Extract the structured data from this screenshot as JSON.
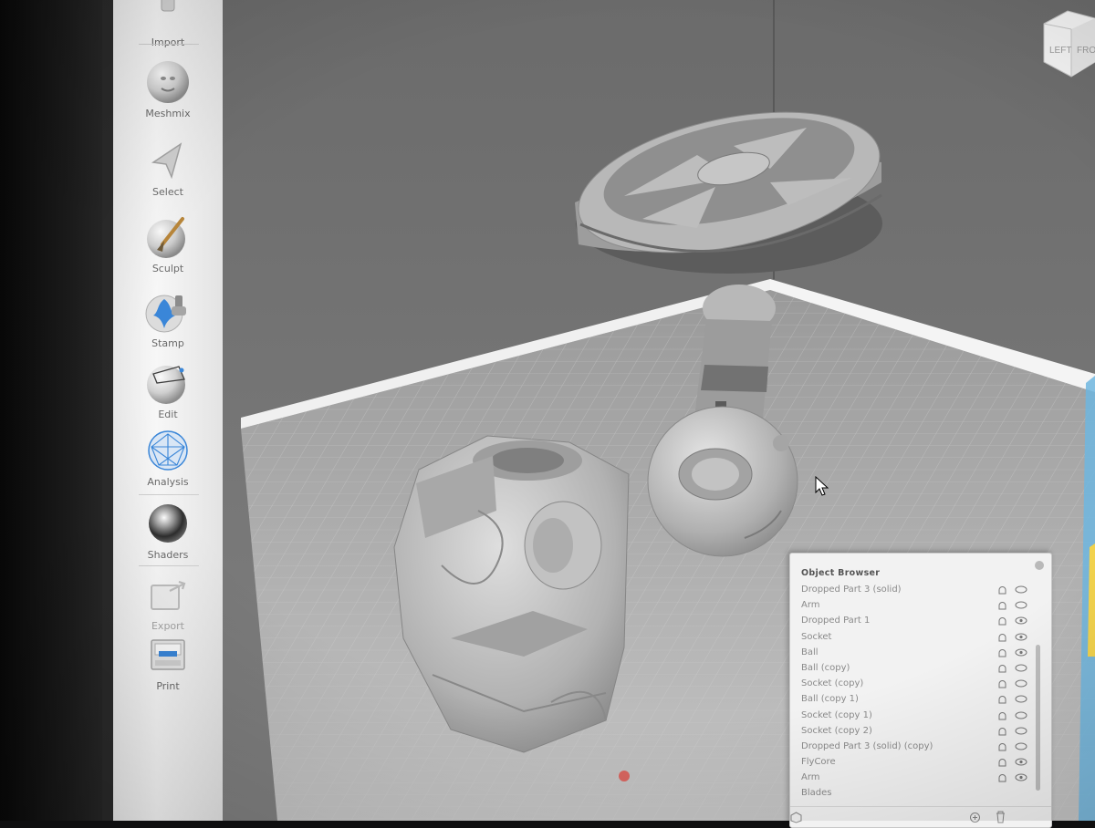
{
  "toolbar": {
    "items": [
      {
        "label": "Import",
        "icon": "import-icon"
      },
      {
        "label": "Meshmix",
        "icon": "meshmix-icon"
      },
      {
        "label": "Select",
        "icon": "select-arrow-icon"
      },
      {
        "label": "Sculpt",
        "icon": "sculpt-brush-icon"
      },
      {
        "label": "Stamp",
        "icon": "stamp-icon"
      },
      {
        "label": "Edit",
        "icon": "edit-sphere-icon"
      },
      {
        "label": "Analysis",
        "icon": "analysis-mesh-icon"
      },
      {
        "label": "Shaders",
        "icon": "shaders-sphere-icon"
      },
      {
        "label": "Export",
        "icon": "export-icon"
      },
      {
        "label": "Print",
        "icon": "printer-icon"
      }
    ]
  },
  "viewcube": {
    "left_label": "LEFT",
    "front_label": "FRO"
  },
  "object_browser": {
    "title": "Object Browser",
    "items": [
      {
        "label": "Dropped Part 3 (solid)"
      },
      {
        "label": "Arm"
      },
      {
        "label": "Dropped Part 1"
      },
      {
        "label": "Socket"
      },
      {
        "label": "Ball"
      },
      {
        "label": "Ball (copy)"
      },
      {
        "label": "Socket (copy)"
      },
      {
        "label": "Ball (copy 1)"
      },
      {
        "label": "Socket (copy 1)"
      },
      {
        "label": "Socket (copy 2)"
      },
      {
        "label": "Dropped Part 3 (solid) (copy)"
      },
      {
        "label": "FlyCore"
      },
      {
        "label": "Arm"
      },
      {
        "label": "Blades"
      }
    ]
  },
  "colors": {
    "toolbar_bg": "#efefef",
    "viewport_bg": "#727272",
    "model_gray": "#b4b4b4",
    "selection_blue": "#3d7ad1"
  }
}
